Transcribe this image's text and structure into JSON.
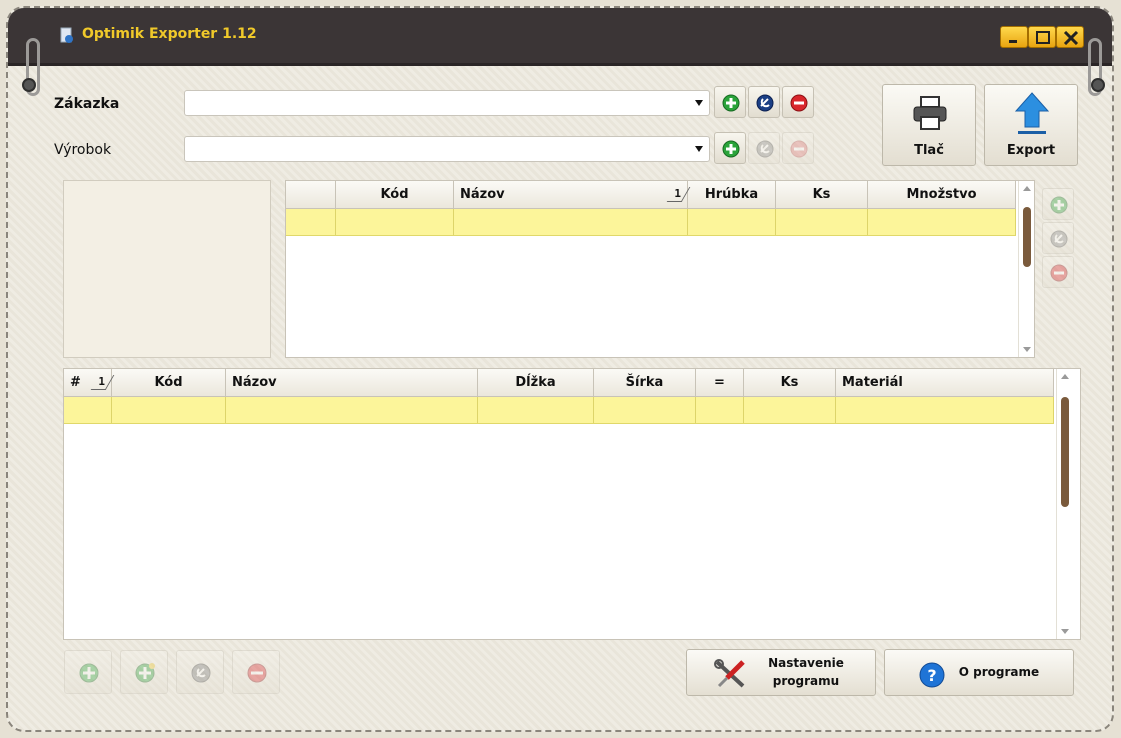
{
  "window": {
    "title": "Optimik Exporter 1.12"
  },
  "form": {
    "zakazka_label": "Zákazka",
    "vyrobok_label": "Výrobok",
    "zakazka_value": "",
    "vyrobok_value": ""
  },
  "toolbar": {
    "print_label": "Tlač",
    "export_label": "Export"
  },
  "upper_grid": {
    "columns": [
      "",
      "Kód",
      "Názov",
      "Hrúbka",
      "Ks",
      "Množstvo"
    ],
    "sort_indicator": "1"
  },
  "lower_grid": {
    "columns": [
      "#",
      "Kód",
      "Názov",
      "Dĺžka",
      "Šírka",
      "=",
      "Ks",
      "Materiál"
    ],
    "sort_indicator": "1"
  },
  "footer": {
    "settings_line1": "Nastavenie",
    "settings_line2": "programu",
    "about_label": "O programe"
  },
  "colors": {
    "titlebar": "#3b3536",
    "title_text": "#f0c92a",
    "selected_row": "#fcf59a"
  }
}
